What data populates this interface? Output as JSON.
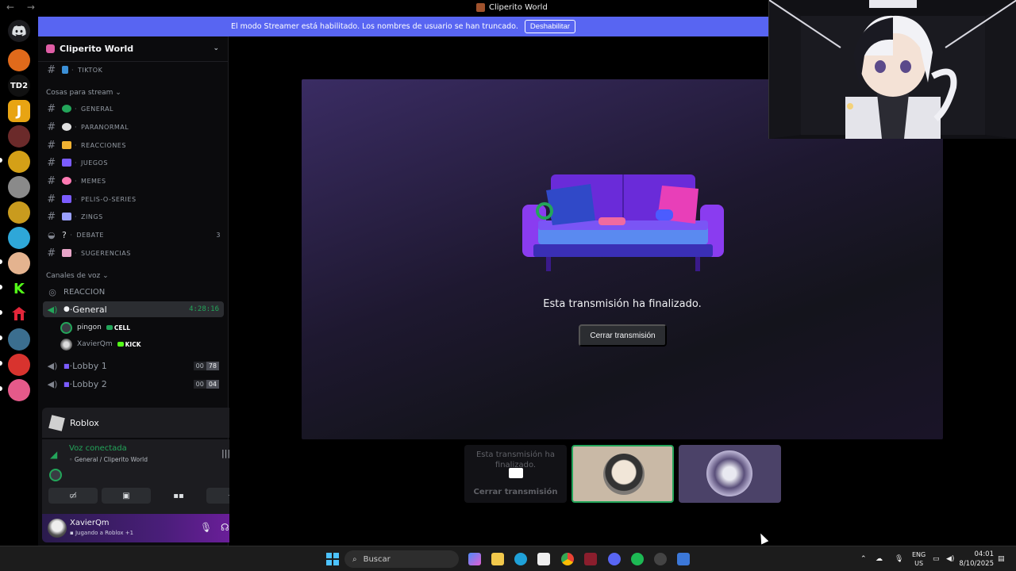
{
  "window": {
    "title": "Cliperito World"
  },
  "banner": {
    "message": "El modo Streamer está habilitado. Los nombres de usuario se han truncado.",
    "button": "Deshabilitar"
  },
  "rail": {
    "top_label": "TD2",
    "j_label": "J",
    "k_label": "K"
  },
  "guild": {
    "name": "Cliperito World"
  },
  "channels": {
    "top": [
      {
        "name": "TIKTOK"
      }
    ],
    "category_stream": "Cosas para stream",
    "stream": [
      {
        "name": "GENERAL",
        "color": "#23a55a"
      },
      {
        "name": "PARANORMAL",
        "color": "#e0e0e0"
      },
      {
        "name": "REACCIONES",
        "color": "#f0b232"
      },
      {
        "name": "JUEGOS",
        "color": "#7b5cff"
      },
      {
        "name": "MEMES",
        "color": "#ff7ab3"
      },
      {
        "name": "PELIS-O-SERIES",
        "color": "#7b5cff"
      },
      {
        "name": "ZINGS",
        "color": "#9aa0ff"
      },
      {
        "name": "DEBATE",
        "color": "#b5bac1",
        "badge": "3",
        "lead": "?"
      },
      {
        "name": "SUGERENCIAS",
        "color": "#e8a5c8"
      }
    ],
    "category_voice": "Canales de voz",
    "voice": [
      {
        "name": "REACCION"
      },
      {
        "name": "General",
        "time": "4:28:16"
      },
      {
        "name": "Lobby 1",
        "cnt_a": "00",
        "cnt_b": "78"
      },
      {
        "name": "Lobby 2",
        "cnt_a": "00",
        "cnt_b": "04"
      }
    ],
    "members": [
      {
        "name": "pingon",
        "tag": "CELL"
      },
      {
        "name": "XavierQm",
        "tag": "KICK"
      }
    ]
  },
  "activity": {
    "name": "Roblox"
  },
  "voice": {
    "status": "Voz conectada",
    "location": "General / Cliperito World"
  },
  "user": {
    "name": "XavierQm",
    "activity": "Jugando a Roblox +1"
  },
  "stage": {
    "ended": "Esta transmisión ha finalizado.",
    "close": "Cerrar transmisión"
  },
  "tiles": {
    "ended": "Esta transmisión ha finalizado.",
    "close": "Cerrar transmisión"
  },
  "taskbar": {
    "search": "Buscar",
    "lang_a": "ENG",
    "lang_b": "US",
    "time": "04:01",
    "date": "8/10/2025"
  },
  "colors": {
    "accent": "#5865f2",
    "online": "#23a55a"
  }
}
